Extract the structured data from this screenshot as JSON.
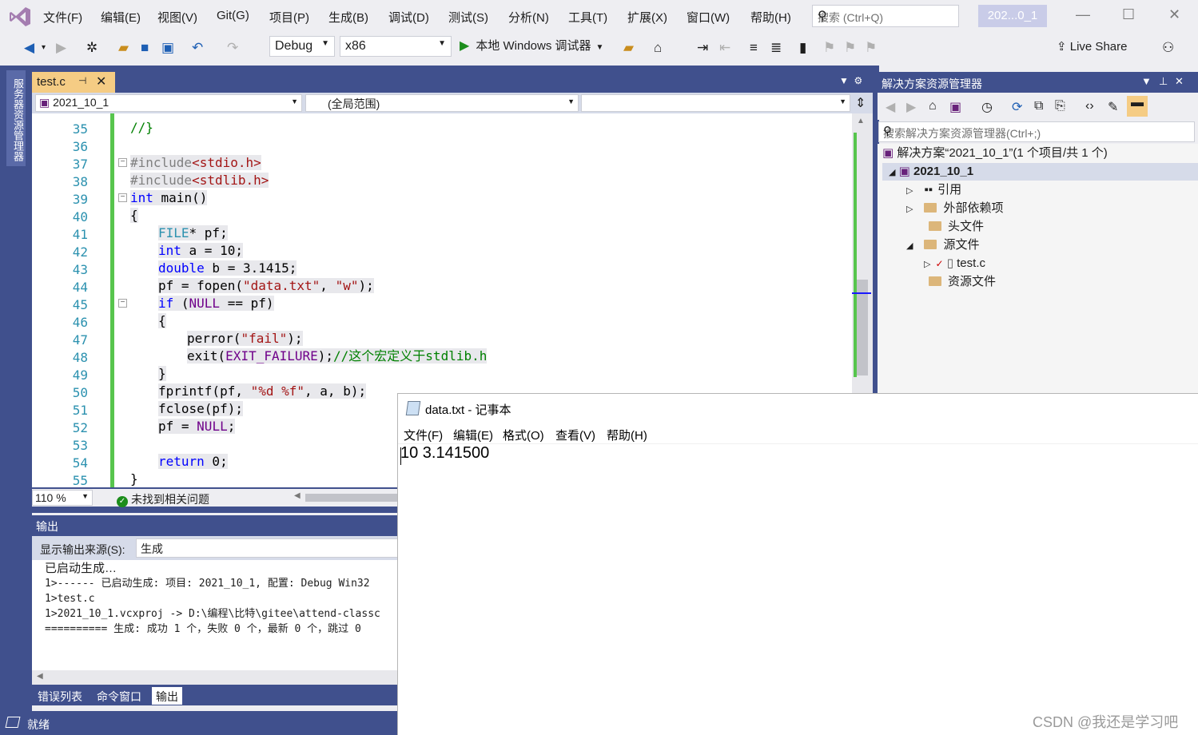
{
  "menu": {
    "items": [
      "文件(F)",
      "编辑(E)",
      "视图(V)",
      "Git(G)",
      "项目(P)",
      "生成(B)",
      "调试(D)",
      "测试(S)",
      "分析(N)",
      "工具(T)",
      "扩展(X)",
      "窗口(W)",
      "帮助(H)"
    ],
    "search_placeholder": "搜索 (Ctrl+Q)",
    "solution_badge": "202...0_1"
  },
  "toolbar": {
    "config": "Debug",
    "platform": "x86",
    "run_label": "本地 Windows 调试器",
    "live_share": "Live Share"
  },
  "left_strip": {
    "server_explorer": "服务器资源管理器"
  },
  "editor": {
    "tab_name": "test.c",
    "nav_project": "2021_10_1",
    "nav_scope": "(全局范围)",
    "zoom": "110 %",
    "issues": "未找到相关问题",
    "line_numbers": [
      "35",
      "36",
      "37",
      "38",
      "39",
      "40",
      "41",
      "42",
      "43",
      "44",
      "45",
      "46",
      "47",
      "48",
      "49",
      "50",
      "51",
      "52",
      "53",
      "54",
      "55"
    ],
    "code": {
      "l35": "//}",
      "l37_a": "#include",
      "l37_b": "<stdio.h>",
      "l38_a": "#include",
      "l38_b": "<stdlib.h>",
      "l39_kw": "int",
      "l39_rest": " main()",
      "l40": "{",
      "l41_ty": "FILE",
      "l41_rest": "* pf;",
      "l42_kw": "int",
      "l42_rest": " a = 10;",
      "l43_kw": "double",
      "l43_rest": " b = 3.1415;",
      "l44_a": "pf = fopen(",
      "l44_s1": "\"data.txt\"",
      "l44_b": ", ",
      "l44_s2": "\"w\"",
      "l44_c": ");",
      "l45_kw": "if",
      "l45_a": " (",
      "l45_mac": "NULL",
      "l45_b": " == pf)",
      "l46": "{",
      "l47_a": "perror(",
      "l47_s": "\"fail\"",
      "l47_b": ");",
      "l48_a": "exit(",
      "l48_mac": "EXIT_FAILURE",
      "l48_b": ");",
      "l48_cm": "//这个宏定义于stdlib.h",
      "l49": "}",
      "l50_a": "fprintf(pf, ",
      "l50_s": "\"%d %f\"",
      "l50_b": ", a, b);",
      "l51": "fclose(pf);",
      "l52_a": "pf = ",
      "l52_mac": "NULL",
      "l52_b": ";",
      "l54_kw": "return",
      "l54_rest": " 0;",
      "l55": "}"
    }
  },
  "output": {
    "title": "输出",
    "source_label": "显示输出来源(S):",
    "source_value": "生成",
    "lines": [
      "已启动生成…",
      "1>------ 已启动生成: 项目: 2021_10_1, 配置: Debug Win32",
      "1>test.c",
      "1>2021_10_1.vcxproj -> D:\\编程\\比特\\gitee\\attend-classc",
      "========== 生成: 成功 1 个，失败 0 个，最新 0 个，跳过 0"
    ],
    "tabs": [
      "错误列表",
      "命令窗口",
      "输出"
    ]
  },
  "status": {
    "text": "就绪"
  },
  "solution_explorer": {
    "title": "解决方案资源管理器",
    "search_placeholder": "搜索解决方案资源管理器(Ctrl+;)",
    "solution": "解决方案“2021_10_1”(1 个项目/共 1 个)",
    "project": "2021_10_1",
    "nodes": [
      "引用",
      "外部依赖项",
      "头文件",
      "源文件",
      "test.c",
      "资源文件"
    ]
  },
  "notepad": {
    "title": "data.txt - 记事本",
    "menu": [
      "文件(F)",
      "编辑(E)",
      "格式(O)",
      "查看(V)",
      "帮助(H)"
    ],
    "content": "10 3.141500"
  },
  "watermark": "CSDN @我还是学习吧"
}
